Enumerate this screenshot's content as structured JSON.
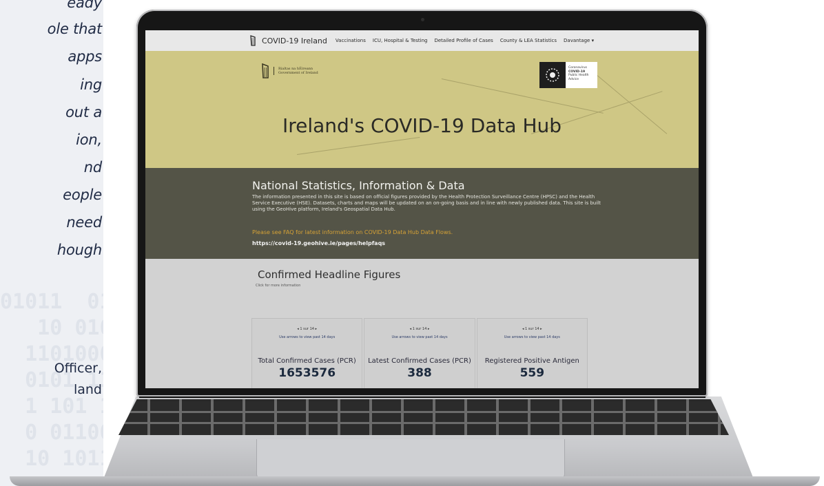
{
  "quote": {
    "lines": [
      "eady",
      "ole that",
      "apps",
      "ing",
      "out a",
      "ion,",
      "nd",
      "eople",
      "need",
      "hough"
    ],
    "attribution": [
      "Officer,",
      "land"
    ]
  },
  "site": {
    "nav": {
      "brand": "COVID-19 Ireland",
      "items": [
        "Vaccinations",
        "ICU, Hospital & Testing",
        "Detailed Profile of Cases",
        "County & LEA Statistics",
        "Davantage ▾"
      ]
    },
    "gov_logo": {
      "line1": "Rialtas na hÉireann",
      "line2": "Government of Ireland"
    },
    "badge": {
      "line1": "Coronavirus",
      "line2": "COVID-19",
      "line3": "Public Health",
      "line4": "Advice"
    },
    "hero_title": "Ireland's COVID-19 Data Hub",
    "stats": {
      "title": "National Statistics, Information & Data",
      "body": "The information presented in this site is based on official figures provided by the Health Protection Surveillance Centre (HPSC) and the Health Service Executive (HSE). Datasets, charts and maps will be updated on an on-going basis and in line with newly published data. This site is built using the GeoHive platform, Ireland's Geospatial Data Hub.",
      "faq": "Please see FAQ for latest information on COVID-19 Data Hub Data Flows.",
      "url": "https://covid-19.geohive.ie/pages/helpfaqs"
    },
    "headline": {
      "title": "Confirmed Headline Figures",
      "subtitle": "Click for more information",
      "cards": [
        {
          "pager": "◂   1 sur 14   ▸",
          "hint": "Use arrows to view past 14 days",
          "label": "Total Confirmed Cases (PCR)",
          "value": "1653576"
        },
        {
          "pager": "◂   1 sur 14   ▸",
          "hint": "Use arrows to view past 14 days",
          "label": "Latest Confirmed Cases (PCR)",
          "value": "388"
        },
        {
          "pager": "◂   1 sur 14   ▸",
          "hint": "Use arrows to view past 14 days",
          "label": "Registered Positive Antigen",
          "value": "559"
        }
      ]
    }
  },
  "colors": {
    "hero_bg": "#cfc785",
    "stats_bg": "#545447",
    "faq_link": "#d6a236",
    "headline_bg": "#d2d2d2"
  }
}
